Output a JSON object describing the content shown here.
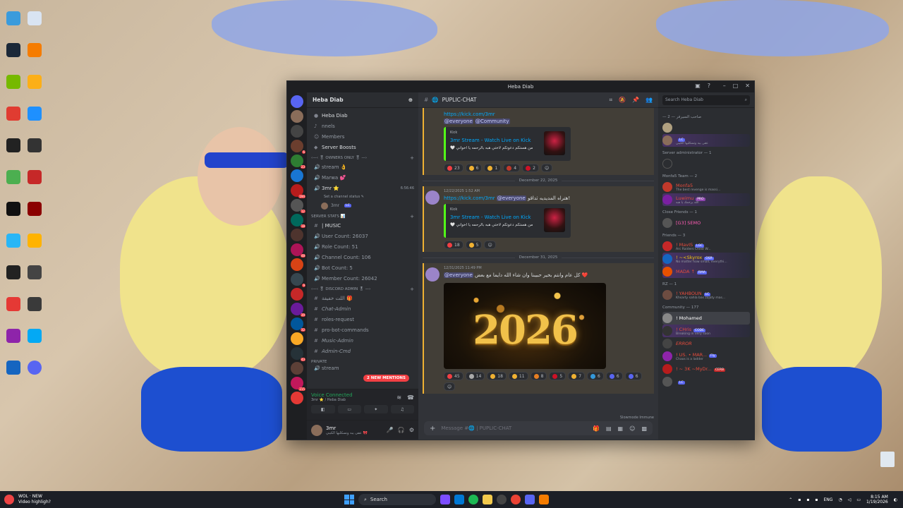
{
  "taskbar": {
    "notif_title": "WOL · NEW",
    "notif_sub": "Video highligh?",
    "search": "Search",
    "lang": "ENG",
    "time": "8:15 AM",
    "date": "1/19/2026"
  },
  "window": {
    "title": "Heba Diab"
  },
  "server": {
    "name": "Heba Diab",
    "tooltip": "Heba Diab",
    "channels_label": "nnels",
    "members_label": "Members",
    "boosts_label": "Server Boosts"
  },
  "channels": {
    "owners_cat": "‹—‹ 🎖 OWNERS ONLY 🎖 —›",
    "stream": "stream 👌",
    "marwa": "Marwa 💕",
    "mr3": "3mr ⭐",
    "mr3_status": "Set a channel status ✎",
    "mr3_time": "6:56:46",
    "voice_user": "3mr",
    "stats_cat": "Server Stats 📊",
    "music": "| MUSIC",
    "user_count": "User Count: 26037",
    "role_count": "Role Count: 51",
    "channel_count": "Channel Count: 106",
    "bot_count": "Bot Count: 5",
    "member_count": "Member Count: 26042",
    "admin_cat": "‹—‹ 🎖 DISCORD ADMIN 🎖 —›",
    "admin_sub": "اللت خفيفة 🎁",
    "chat_admin": "Chat-Admin",
    "roles_request": "roles-request",
    "pro_bot": "pro-bot-commands",
    "music_admin": "Music-Admin",
    "admin_cmd": "Admin-Cmd",
    "private_cat": "Private",
    "stream2": "stream"
  },
  "mentions_pill": "2 NEW MENTIONS",
  "voice": {
    "title": "Voice Connected",
    "sub": "3mr ⭐ / Heba Diab"
  },
  "user": {
    "name": "3mr",
    "status": "عفى يبه وتسكليها الكيبي 🎀"
  },
  "chat": {
    "channel": "PUPLIC-CHAT",
    "composer_placeholder": "Message #🌐 | PUPLIC-CHAT",
    "slowmode": "Slowmode Immune",
    "msg1_link": "https://kick.com/3mr",
    "msg1_mention": "@everyone",
    "msg1_mention2": "@Community",
    "embed_provider": "Kick",
    "embed_title": "3mr Stream - Watch Live on Kick",
    "embed_desc": "🤍 من هستكم دعوتكم لاختي هبه بالرحمه يا اخواني",
    "r1": [
      "23",
      "6",
      "1",
      "4",
      "2"
    ],
    "date1": "December 22, 2025",
    "msg2_meta": "12/22/2025 1:52 AM",
    "msg2_text": "هتراه المديديه ثداقو!",
    "msg2_link": "https://kick.com/3mr",
    "msg2_mention": "@everyone",
    "r2": [
      "18",
      "5"
    ],
    "date2": "December 31, 2025",
    "msg3_meta": "12/31/2025 11:49 PM",
    "msg3_mention": "@everyone",
    "msg3_text": "كل عام وانتم بخير حبيبنا وان شاء الله دايما مع بعض ❤️",
    "image_text": "2026",
    "r3": [
      "45",
      "14",
      "18",
      "11",
      "8",
      "5",
      "7",
      "6",
      "6",
      "6"
    ]
  },
  "members": {
    "search_placeholder": "Search Heba Diab",
    "role1": "— صاحب السيرفر — 2",
    "role2": "Server administrator — 1",
    "role3": "Monfa5 Team — 2",
    "role4": "Close Friends — 1",
    "role5": "Friends — 3",
    "role6": "RZ — 1",
    "role7": "Community — 177",
    "m_lc_name": "LC",
    "m_lc_sub": "عفى يبه وتسكليها الكيبي",
    "m_team1": "Monfa5",
    "m_team1_sub": "The best revenge is massi...",
    "m_team2": "Luwimu",
    "m_team2_sub": "الله يرحمك يا هبه",
    "m_close": "[G3] SEMO",
    "m_f1": "! MavIS",
    "m_f1_sub": "Arc Raiders Chest W...",
    "m_f2": "! ~<Skyrox",
    "m_f2_sub": "No matter how small, everythi...",
    "m_f3": "MADA ↑",
    "m_rz": "! YAHBOUN",
    "m_rz_sub": "Khsarty sahla bas zajaty mas...",
    "m_c1": "! Mohamed",
    "m_c2": "! CHris",
    "m_c2_sub": "Breaking in very soon",
    "m_c3": "ERROR",
    "m_c4": "! US. • MAR...",
    "m_c4_sub": "Chaos is a ladder",
    "m_c5": "! ~ 3K ~MyDr...",
    "m_c6": "LC"
  },
  "colors": {
    "accent": "#5865f2",
    "online": "#23a55a",
    "mention_red": "#f23f43",
    "link": "#00a8fc",
    "kick_green": "#53fc18"
  }
}
